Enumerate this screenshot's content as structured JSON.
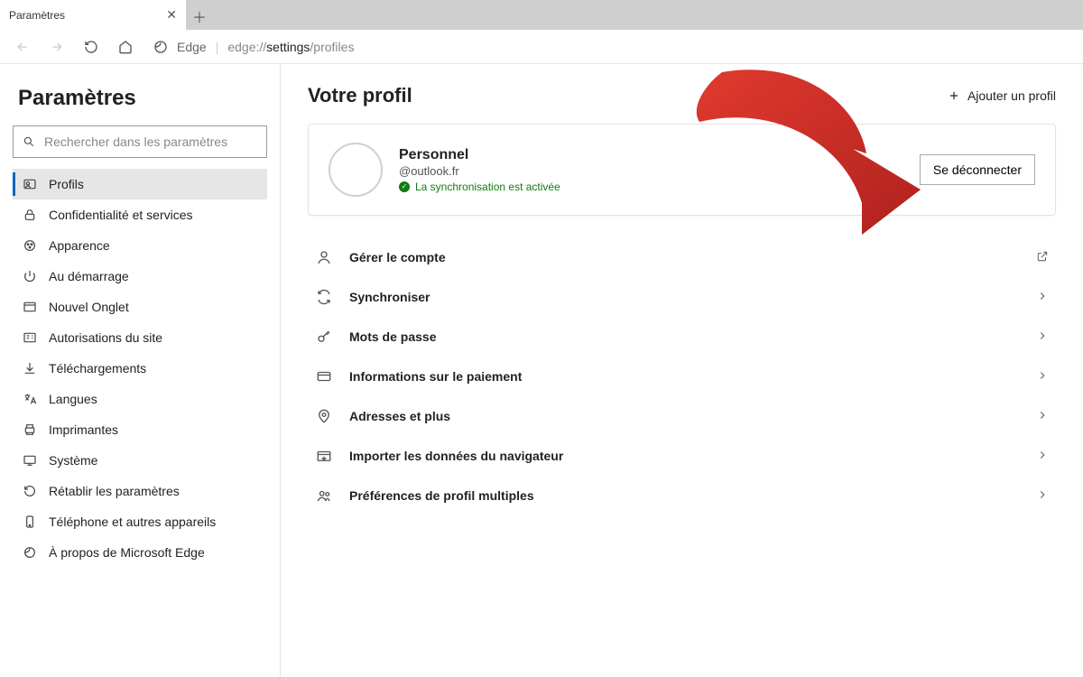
{
  "tab": {
    "title": "Paramètres"
  },
  "address": {
    "app_label": "Edge",
    "prefix": "edge://",
    "bold": "settings",
    "suffix": "/profiles"
  },
  "sidebar": {
    "title": "Paramètres",
    "search_placeholder": "Rechercher dans les paramètres",
    "items": [
      {
        "label": "Profils",
        "active": true
      },
      {
        "label": "Confidentialité et services"
      },
      {
        "label": "Apparence"
      },
      {
        "label": "Au démarrage"
      },
      {
        "label": "Nouvel Onglet"
      },
      {
        "label": "Autorisations du site"
      },
      {
        "label": "Téléchargements"
      },
      {
        "label": "Langues"
      },
      {
        "label": "Imprimantes"
      },
      {
        "label": "Système"
      },
      {
        "label": "Rétablir les paramètres"
      },
      {
        "label": "Téléphone et autres appareils"
      },
      {
        "label": "À propos de Microsoft Edge"
      }
    ]
  },
  "main": {
    "title": "Votre profil",
    "add_profile": "Ajouter un profil",
    "profile": {
      "name": "Personnel",
      "email": "@outlook.fr",
      "sync_status": "La synchronisation est activée",
      "signout": "Se déconnecter"
    },
    "options": [
      {
        "label": "Gérer le compte",
        "trail": "external"
      },
      {
        "label": "Synchroniser",
        "trail": "chevron"
      },
      {
        "label": "Mots de passe",
        "trail": "chevron"
      },
      {
        "label": "Informations sur le paiement",
        "trail": "chevron"
      },
      {
        "label": "Adresses et plus",
        "trail": "chevron"
      },
      {
        "label": "Importer les données du navigateur",
        "trail": "chevron"
      },
      {
        "label": "Préférences de profil multiples",
        "trail": "chevron"
      }
    ]
  }
}
